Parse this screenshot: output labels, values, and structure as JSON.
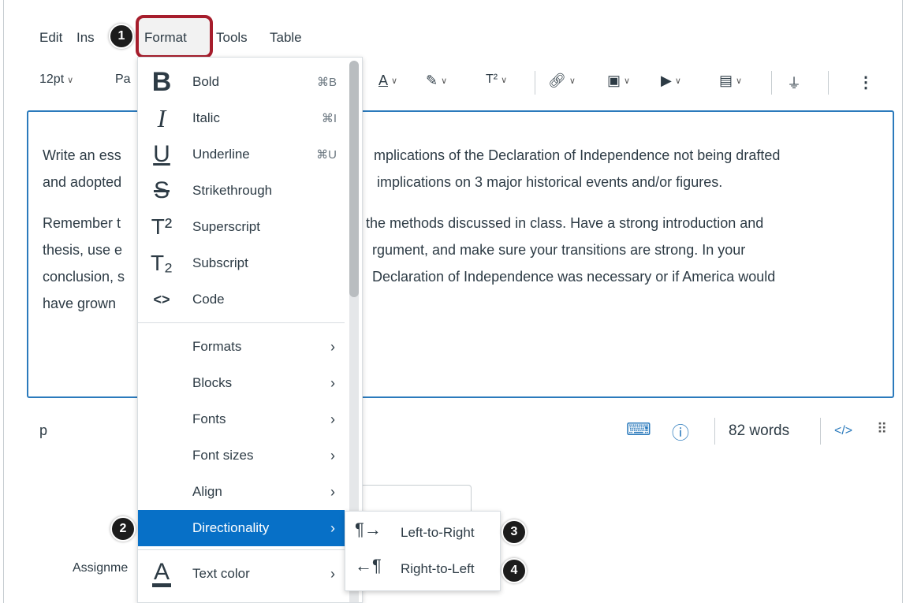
{
  "menubar": {
    "edit": "Edit",
    "insert_partial": "Ins",
    "format": "Format",
    "tools": "Tools",
    "table": "Table"
  },
  "toolbar": {
    "font_size": "12pt",
    "paragraph_partial": "Pa",
    "superscript_label": "T²"
  },
  "editor": {
    "paragraph1": [
      "Write an ess",
      "mplications of the Declaration of Independence not being drafted",
      "and adopted",
      "implications on 3 major historical events and/or figures."
    ],
    "paragraph2": [
      "Remember t",
      "the methods discussed in class. Have a strong introduction and",
      "thesis, use e",
      "rgument, and make sure your transitions are strong. In your",
      "conclusion, s",
      "Declaration of Independence was necessary or if America would",
      "have grown"
    ]
  },
  "status": {
    "path": "p",
    "word_count": "82 words",
    "html_toggle": "</>"
  },
  "assignment_label_partial": "Assignme",
  "format_menu": {
    "items": [
      {
        "icon": "B",
        "label": "Bold",
        "shortcut": "⌘B"
      },
      {
        "icon": "I",
        "label": "Italic",
        "shortcut": "⌘I"
      },
      {
        "icon": "U",
        "label": "Underline",
        "shortcut": "⌘U"
      },
      {
        "icon": "S",
        "label": "Strikethrough",
        "shortcut": ""
      },
      {
        "icon": "T²",
        "label": "Superscript",
        "shortcut": ""
      },
      {
        "icon": "T₂",
        "label": "Subscript",
        "shortcut": ""
      },
      {
        "icon": "<>",
        "label": "Code",
        "shortcut": ""
      }
    ],
    "submenus": [
      {
        "label": "Formats"
      },
      {
        "label": "Blocks"
      },
      {
        "label": "Fonts"
      },
      {
        "label": "Font sizes"
      },
      {
        "label": "Align"
      },
      {
        "label": "Directionality"
      },
      {
        "label": "Text color"
      }
    ],
    "text_color_icon": "A"
  },
  "directionality_submenu": {
    "ltr": "Left-to-Right",
    "rtl": "Right-to-Left"
  },
  "callouts": [
    "1",
    "2",
    "3",
    "4"
  ],
  "colors": {
    "accent": "#0770c7",
    "callout_border": "#a61d2c",
    "editor_border": "#2b7abc"
  }
}
